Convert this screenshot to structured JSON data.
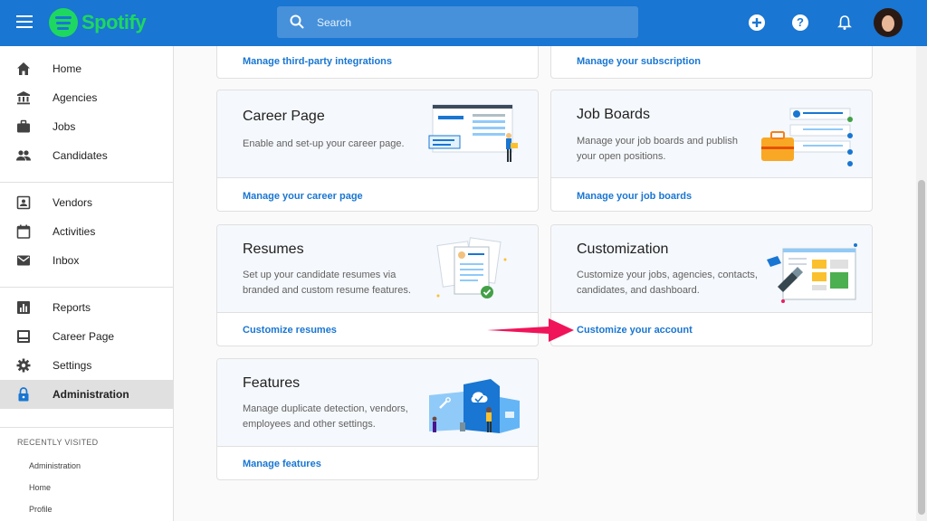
{
  "brand": {
    "name": "Spotify"
  },
  "search": {
    "placeholder": "Search"
  },
  "header": {
    "help_label": "?"
  },
  "sidebar": {
    "items": [
      {
        "label": "Home",
        "icon": "home-icon"
      },
      {
        "label": "Agencies",
        "icon": "bank-icon"
      },
      {
        "label": "Jobs",
        "icon": "briefcase-icon"
      },
      {
        "label": "Candidates",
        "icon": "people-icon"
      },
      {
        "label": "Vendors",
        "icon": "contact-card-icon"
      },
      {
        "label": "Activities",
        "icon": "calendar-icon"
      },
      {
        "label": "Inbox",
        "icon": "mail-icon"
      },
      {
        "label": "Reports",
        "icon": "bar-chart-icon"
      },
      {
        "label": "Career Page",
        "icon": "web-page-icon"
      },
      {
        "label": "Settings",
        "icon": "gear-icon"
      },
      {
        "label": "Administration",
        "icon": "lock-icon",
        "active": true
      }
    ],
    "recent": {
      "title": "RECENTLY VISITED",
      "items": [
        "Administration",
        "Home",
        "Profile"
      ]
    }
  },
  "cards": {
    "integrations": {
      "link": "Manage third-party integrations"
    },
    "subscription": {
      "link": "Manage your subscription"
    },
    "career_page": {
      "title": "Career Page",
      "desc": "Enable and set-up your career page.",
      "link": "Manage your career page"
    },
    "job_boards": {
      "title": "Job Boards",
      "desc": "Manage your job boards and publish your open positions.",
      "link": "Manage your job boards"
    },
    "resumes": {
      "title": "Resumes",
      "desc": "Set up your candidate resumes via branded and custom resume features.",
      "link": "Customize resumes"
    },
    "customization": {
      "title": "Customization",
      "desc": "Customize your jobs, agencies, contacts, candidates, and dashboard.",
      "link": "Customize your account"
    },
    "features": {
      "title": "Features",
      "desc": "Manage duplicate detection, vendors, employees and other settings.",
      "link": "Manage features"
    }
  },
  "colors": {
    "primary": "#1976d2",
    "brand_green": "#1ed760",
    "annotation_arrow": "#f0145a"
  }
}
